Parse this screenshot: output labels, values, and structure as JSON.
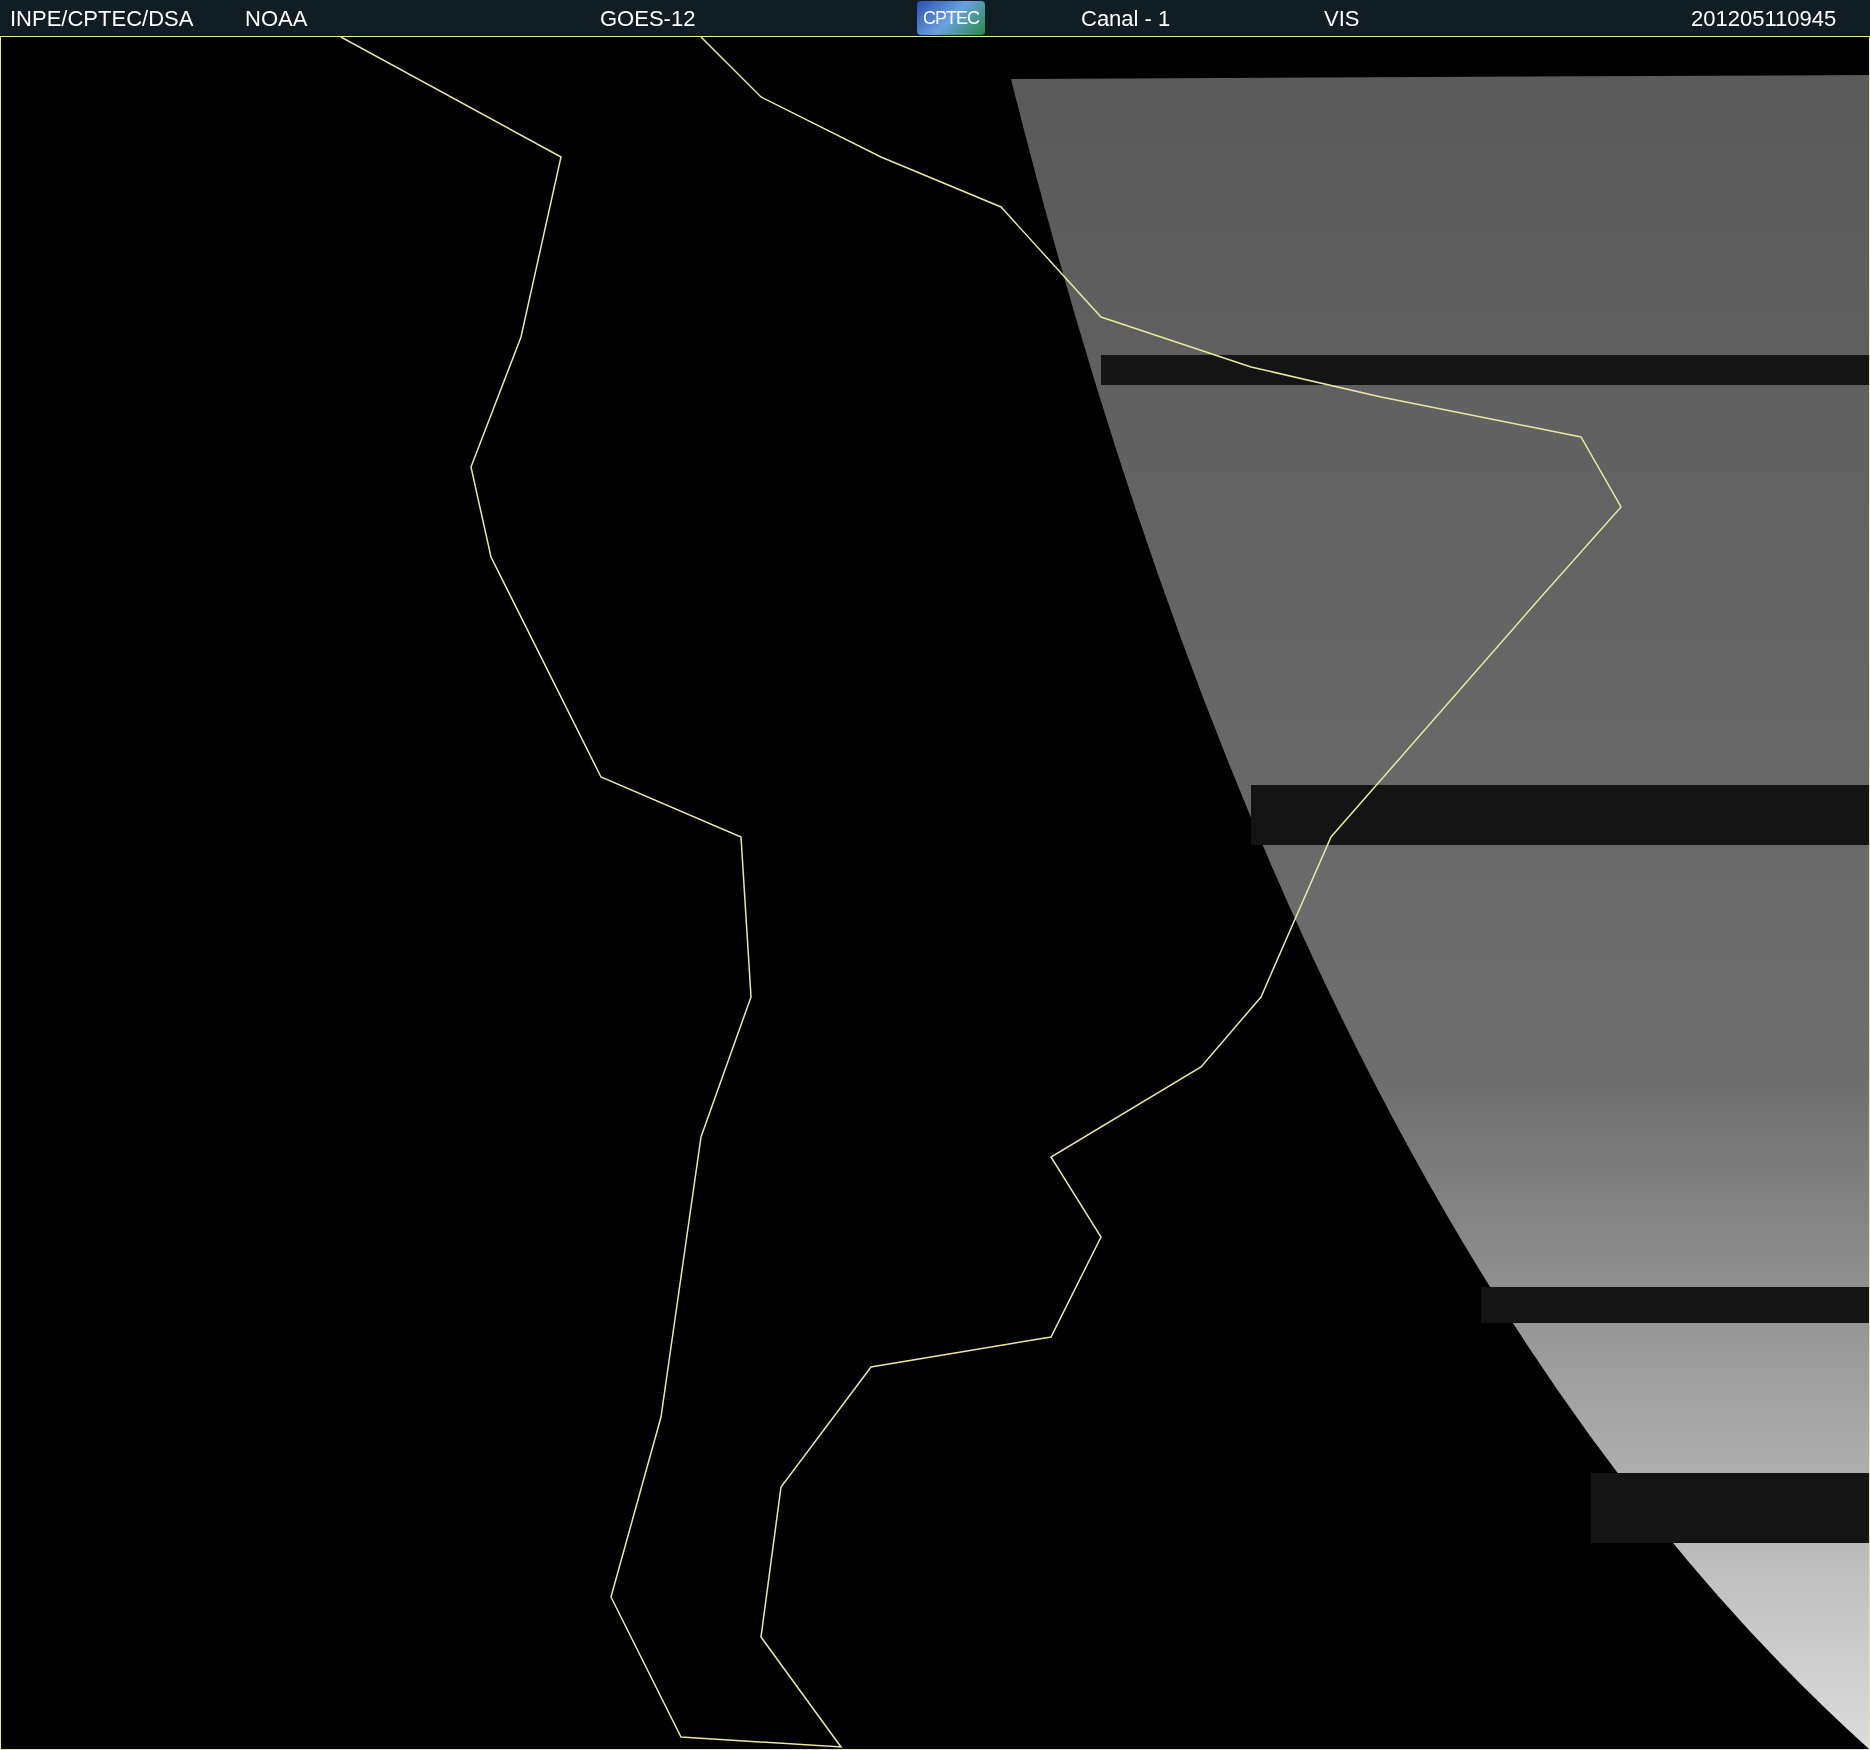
{
  "header": {
    "source": "INPE/CPTEC/DSA",
    "agency": "NOAA",
    "satellite": "GOES-12",
    "logo": "CPTEC",
    "channel": "Canal - 1",
    "band": "VIS",
    "timestamp": "201205110945"
  }
}
